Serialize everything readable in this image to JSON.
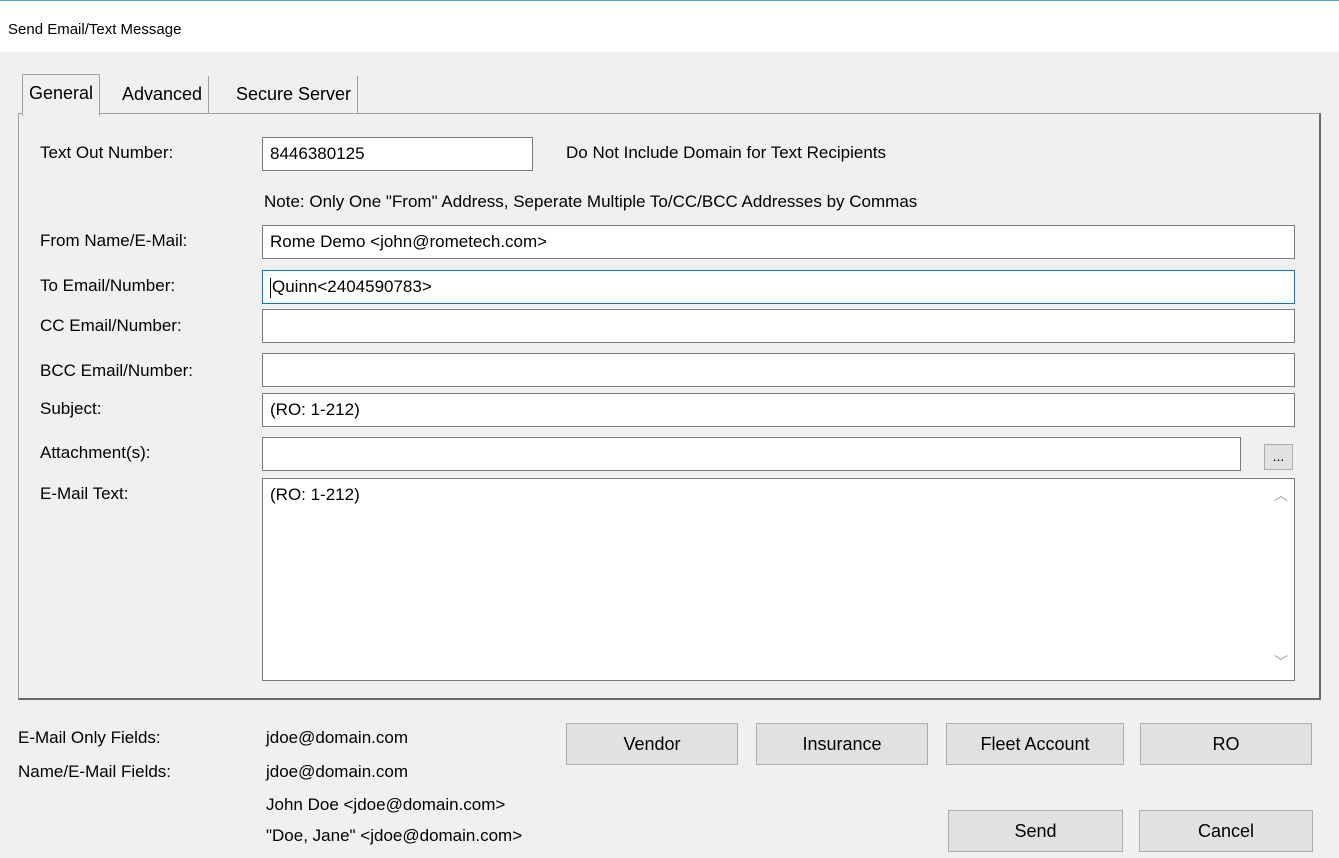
{
  "window": {
    "title": "Send Email/Text Message"
  },
  "tabs": [
    {
      "label": "General",
      "active": true
    },
    {
      "label": "Advanced",
      "active": false
    },
    {
      "label": "Secure Server",
      "active": false
    }
  ],
  "general": {
    "text_out_label": "Text Out Number:",
    "text_out_value": "8446380125",
    "text_out_hint": "Do Not Include Domain for Text Recipients",
    "note": "Note:  Only One \"From\" Address, Seperate Multiple To/CC/BCC Addresses by Commas",
    "from_label": "From Name/E-Mail:",
    "from_value": "Rome Demo <john@rometech.com>",
    "to_label": "To Email/Number:",
    "to_value": "Quinn<2404590783>",
    "cc_label": "CC Email/Number:",
    "cc_value": "",
    "bcc_label": "BCC Email/Number:",
    "bcc_value": "",
    "subject_label": "Subject:",
    "subject_value": "(RO: 1-212)",
    "attach_label": "Attachment(s):",
    "attach_value": "",
    "browse_label": "...",
    "body_label": "E-Mail Text:",
    "body_value": "(RO: 1-212)"
  },
  "footer": {
    "email_only_label": "E-Mail Only Fields:",
    "email_only_example": "jdoe@domain.com",
    "name_email_label": "Name/E-Mail Fields:",
    "name_email_examples": [
      "jdoe@domain.com",
      "John Doe <jdoe@domain.com>",
      "\"Doe, Jane\" <jdoe@domain.com>"
    ],
    "buttons": {
      "vendor": "Vendor",
      "insurance": "Insurance",
      "fleet": "Fleet Account",
      "ro": "RO",
      "send": "Send",
      "cancel": "Cancel"
    }
  },
  "colors": {
    "focus_border": "#0078d7",
    "window_bg": "#f0f0f0"
  }
}
